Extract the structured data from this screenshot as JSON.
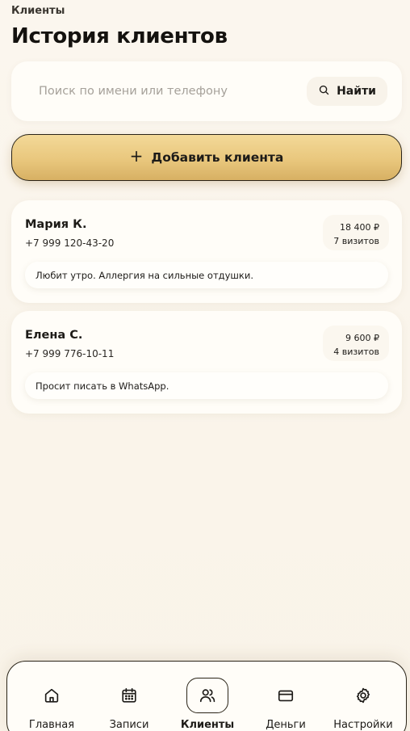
{
  "header": {
    "breadcrumb": "Клиенты",
    "title": "История клиентов"
  },
  "search": {
    "placeholder": "Поиск по имени или телефону",
    "value": "",
    "button_label": "Найти"
  },
  "add_button_label": "Добавить клиента",
  "clients": [
    {
      "name": "Мария К.",
      "phone": "+7 999 120-43-20",
      "amount": "18 400 ₽",
      "visits": "7 визитов",
      "note": "Любит утро. Аллергия на сильные отдушки."
    },
    {
      "name": "Елена С.",
      "phone": "+7 999 776-10-11",
      "amount": "9 600 ₽",
      "visits": "4 визитов",
      "note": "Просит писать в WhatsApp."
    }
  ],
  "tabbar": {
    "items": [
      {
        "label": "Главная",
        "icon": "home-icon"
      },
      {
        "label": "Записи",
        "icon": "calendar-icon"
      },
      {
        "label": "Клиенты",
        "icon": "users-icon",
        "active": true
      },
      {
        "label": "Деньги",
        "icon": "card-icon"
      },
      {
        "label": "Настройки",
        "icon": "gear-icon"
      }
    ]
  },
  "colors": {
    "background": "#faf5ec",
    "card": "#fffdf8",
    "accent_gold": "#e9c77d",
    "text": "#1d1b18"
  }
}
